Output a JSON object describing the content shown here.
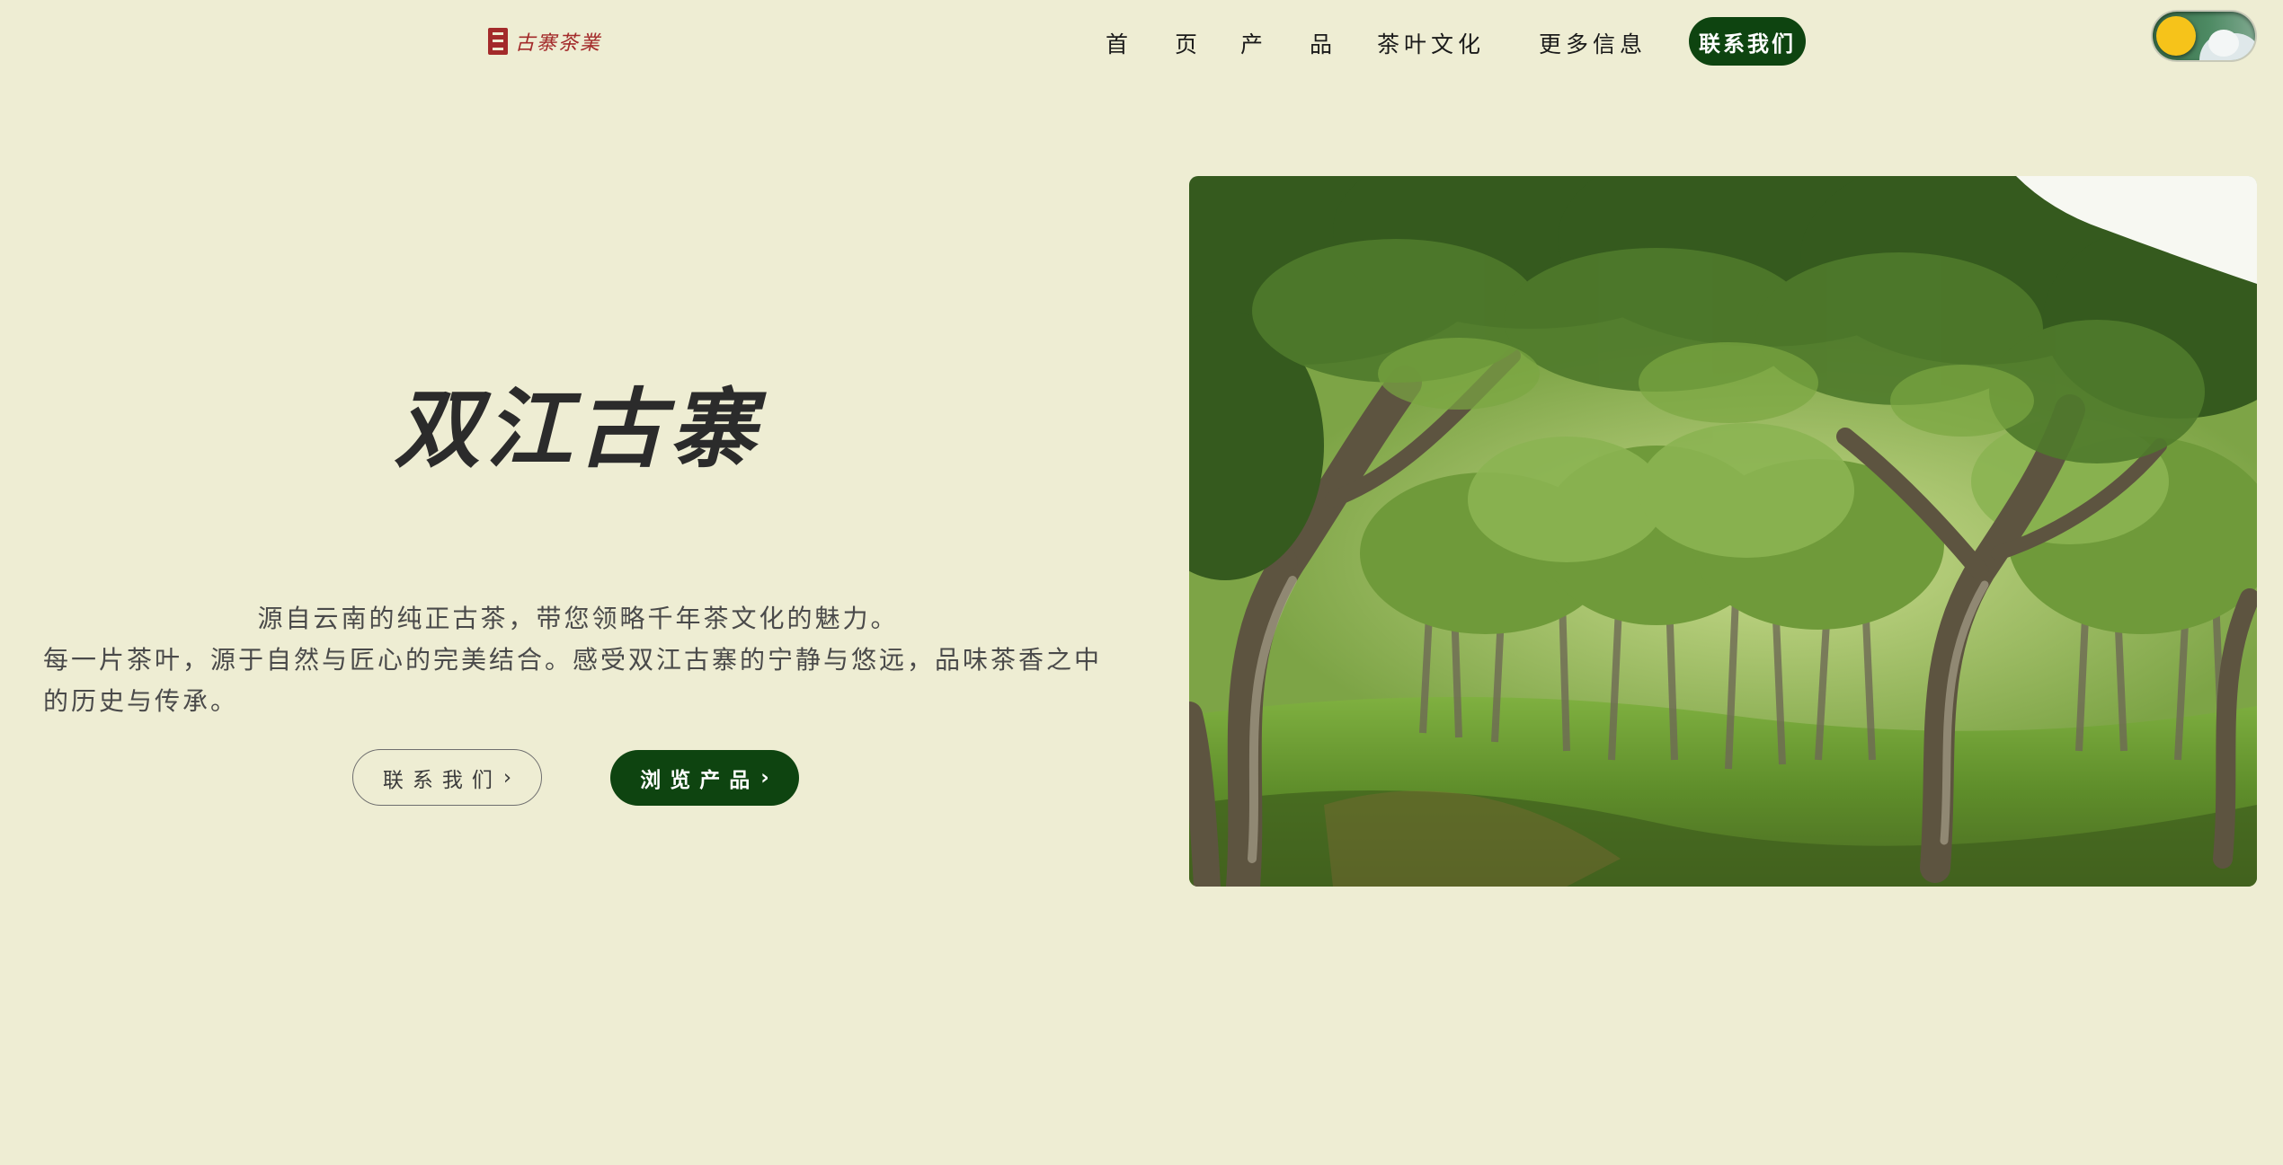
{
  "header": {
    "logo_text": "古寨茶業",
    "nav": {
      "home": "首 页",
      "products": "产 品",
      "culture": "茶叶文化",
      "more": "更多信息",
      "contact": "联系我们"
    }
  },
  "hero": {
    "title": "双江古寨",
    "description_line1": "源自云南的纯正古茶，带您领略千年茶文化的魅力。",
    "description_line2": "每一片茶叶，源于自然与匠心的完美结合。感受双江古寨的宁静与悠远，品味茶香之中的历史与传承。",
    "contact_button": "联系我们",
    "browse_button": "浏览产品",
    "chevron": "›"
  },
  "colors": {
    "background": "#eeedd3",
    "accent_green": "#0e4410",
    "logo_red": "#a32a2a",
    "text_dark": "#2b2b2b"
  },
  "icons": {
    "toggle": "sun-theme-toggle-icon",
    "chevron": "chevron-right-icon"
  }
}
